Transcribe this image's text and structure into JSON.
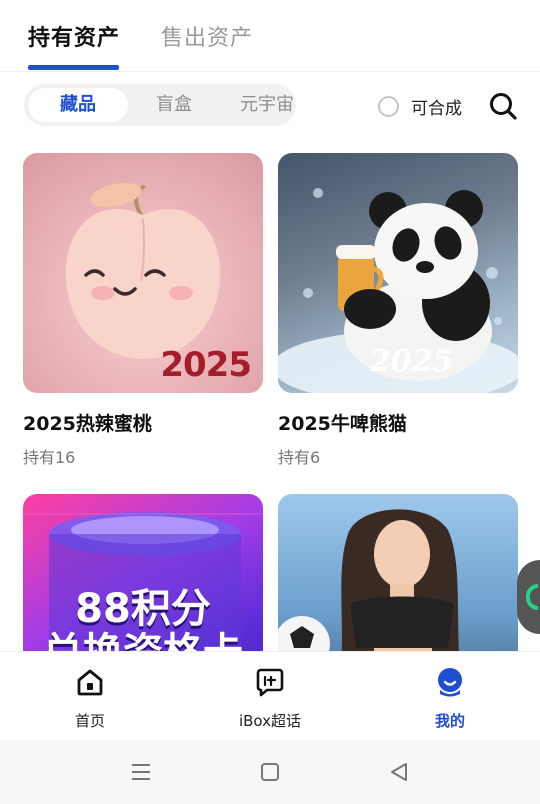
{
  "top_tabs": {
    "held": "持有资产",
    "sold": "售出资产"
  },
  "filter": {
    "segments": [
      "藏品",
      "盲盒",
      "元宇宙"
    ],
    "combinable_label": "可合成"
  },
  "cards": [
    {
      "title": "2025热辣蜜桃",
      "holding": "持有16",
      "art_text": "2025"
    },
    {
      "title": "2025牛啤熊猫",
      "holding": "持有6",
      "art_text": "2025"
    },
    {
      "art_line1": "88积分",
      "art_line2": "兑换资格卡"
    },
    {}
  ],
  "bottom_nav": [
    {
      "label": "首页",
      "icon": "home-icon"
    },
    {
      "label": "iBox超话",
      "icon": "chat-bubble-icon"
    },
    {
      "label": "我的",
      "icon": "profile-icon"
    }
  ],
  "colors": {
    "accent": "#1f4fd1"
  }
}
